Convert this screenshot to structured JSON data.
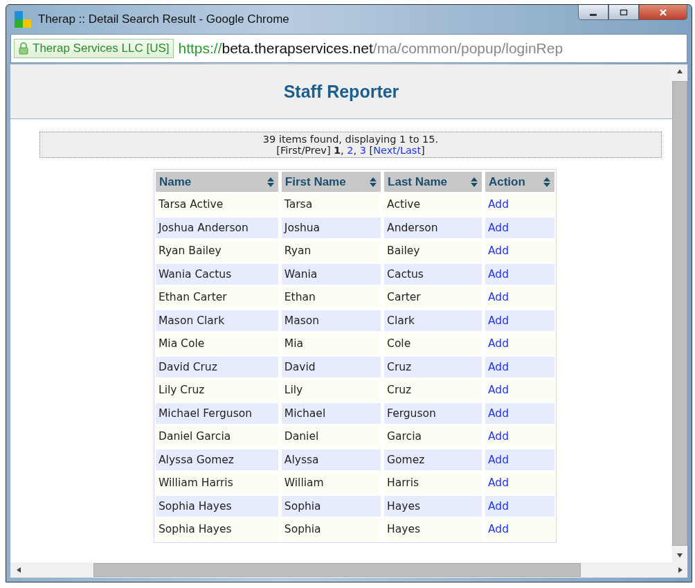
{
  "window": {
    "title": "Therap ::  Detail Search Result - Google Chrome"
  },
  "address_bar": {
    "identity": "Therap Services LLC [US]",
    "scheme": "https://",
    "host": "beta.therapservices.net",
    "path": "/ma/common/popup/loginRep"
  },
  "heading": "Staff Reporter",
  "pager": {
    "summary": "39 items found, displaying 1 to 15.",
    "parts": [
      {
        "text": "[First/Prev]",
        "kind": "plain"
      },
      {
        "text": "1",
        "kind": "current"
      },
      {
        "text": ", ",
        "kind": "plain"
      },
      {
        "text": "2",
        "kind": "link"
      },
      {
        "text": ", ",
        "kind": "plain"
      },
      {
        "text": "3",
        "kind": "link"
      },
      {
        "text": " [",
        "kind": "plain"
      },
      {
        "text": "Next",
        "kind": "link"
      },
      {
        "text": "/",
        "kind": "link"
      },
      {
        "text": "Last",
        "kind": "link"
      },
      {
        "text": "]",
        "kind": "plain"
      }
    ]
  },
  "table": {
    "columns": [
      "Name",
      "First Name",
      "Last Name",
      "Action"
    ],
    "rows": [
      [
        "Tarsa Active",
        "Tarsa",
        "Active",
        "Add"
      ],
      [
        "Joshua Anderson",
        "Joshua",
        "Anderson",
        "Add"
      ],
      [
        "Ryan Bailey",
        "Ryan",
        "Bailey",
        "Add"
      ],
      [
        "Wania Cactus",
        "Wania",
        "Cactus",
        "Add"
      ],
      [
        "Ethan Carter",
        "Ethan",
        "Carter",
        "Add"
      ],
      [
        "Mason Clark",
        "Mason",
        "Clark",
        "Add"
      ],
      [
        "Mia Cole",
        "Mia",
        "Cole",
        "Add"
      ],
      [
        "David Cruz",
        "David",
        "Cruz",
        "Add"
      ],
      [
        "Lily Cruz",
        "Lily",
        "Cruz",
        "Add"
      ],
      [
        "Michael Ferguson",
        "Michael",
        "Ferguson",
        "Add"
      ],
      [
        "Daniel Garcia",
        "Daniel",
        "Garcia",
        "Add"
      ],
      [
        "Alyssa Gomez",
        "Alyssa",
        "Gomez",
        "Add"
      ],
      [
        "William Harris",
        "William",
        "Harris",
        "Add"
      ],
      [
        "Sophia Hayes",
        "Sophia",
        "Hayes",
        "Add"
      ],
      [
        "Sophia Hayes",
        "Sophia",
        "Hayes",
        "Add"
      ]
    ]
  }
}
